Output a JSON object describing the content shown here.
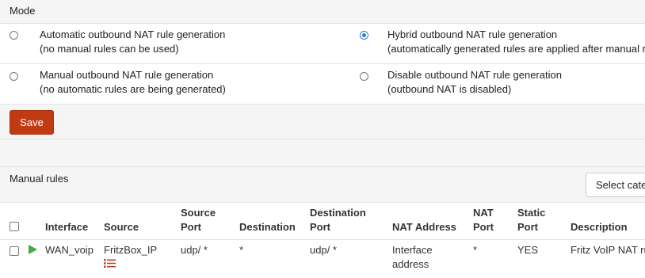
{
  "mode": {
    "title": "Mode",
    "options": [
      {
        "line1": "Automatic outbound NAT rule generation",
        "line2": "(no manual rules can be used)",
        "selected": false
      },
      {
        "line1": "Hybrid outbound NAT rule generation",
        "line2": "(automatically generated rules are applied after manual rules)",
        "selected": true
      },
      {
        "line1": "Manual outbound NAT rule generation",
        "line2": "(no automatic rules are being generated)",
        "selected": false
      },
      {
        "line1": "Disable outbound NAT rule generation",
        "line2": "(outbound NAT is disabled)",
        "selected": false
      }
    ],
    "save_label": "Save"
  },
  "manual_rules": {
    "title": "Manual rules",
    "select_category_label": "Select category",
    "columns": {
      "interface": "Interface",
      "source": "Source",
      "source_port_1": "Source",
      "source_port_2": "Port",
      "destination": "Destination",
      "destination_port_1": "Destination",
      "destination_port_2": "Port",
      "nat_address": "NAT Address",
      "nat_port_1": "NAT",
      "nat_port_2": "Port",
      "static_port_1": "Static",
      "static_port_2": "Port",
      "description": "Description"
    },
    "rows": [
      {
        "interface": "WAN_voip",
        "source": "FritzBox_IP",
        "source_port": "udp/ *",
        "destination": "*",
        "destination_port": "udp/ *",
        "nat_address_1": "Interface",
        "nat_address_2": "address",
        "nat_port": "*",
        "static_port": "YES",
        "description": "Fritz VoIP NAT rule"
      }
    ]
  },
  "colors": {
    "save_button": "#c03b14",
    "radio_selected": "#2b7bd6",
    "enabled_icon": "#3fae3f",
    "alias_icon": "#c0392b"
  },
  "icons": {
    "enabled": "play-icon",
    "alias": "list-icon"
  }
}
